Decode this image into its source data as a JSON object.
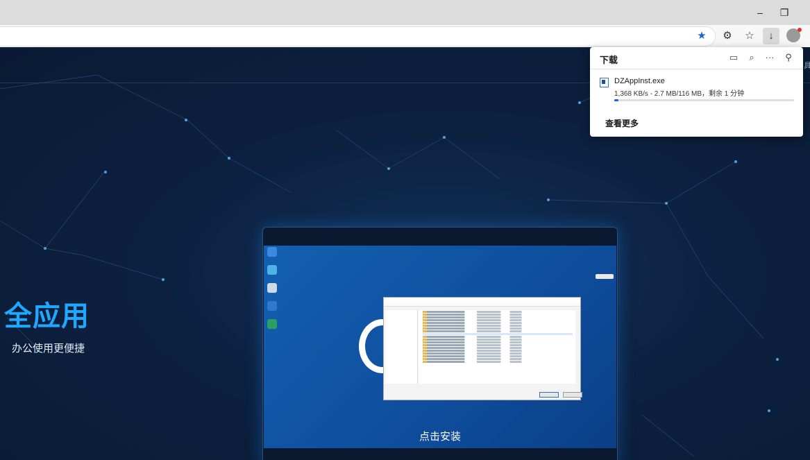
{
  "browser": {
    "window_buttons": {
      "minimize": "–",
      "restore": "❐"
    },
    "toolbar_icons": [
      {
        "name": "favorite-star-icon",
        "glyph": "★"
      },
      {
        "name": "extensions-icon",
        "glyph": "⚙"
      },
      {
        "name": "favorites-icon",
        "glyph": "☆"
      },
      {
        "name": "downloads-icon",
        "glyph": "↓"
      }
    ]
  },
  "page": {
    "hero_title": "全应用",
    "hero_subtitle": "办公使用更便捷",
    "install_label": "点击安装",
    "edge_fragment": "具"
  },
  "downloads_panel": {
    "title": "下载",
    "icons": [
      {
        "name": "open-folder-icon",
        "glyph": "▭"
      },
      {
        "name": "search-icon",
        "glyph": "⌕"
      },
      {
        "name": "more-options-icon",
        "glyph": "···"
      },
      {
        "name": "pin-icon",
        "glyph": "⚲"
      }
    ],
    "file_name": "DZAppInst.exe",
    "status": "1,368 KB/s - 2.7 MB/116 MB，剩余 1 分钟",
    "progress_fraction": 0.023,
    "see_more": "查看更多"
  },
  "colors": {
    "accent": "#1666d9",
    "hero_title": "#1ea8ff",
    "page_bg": "#0b1a30"
  }
}
